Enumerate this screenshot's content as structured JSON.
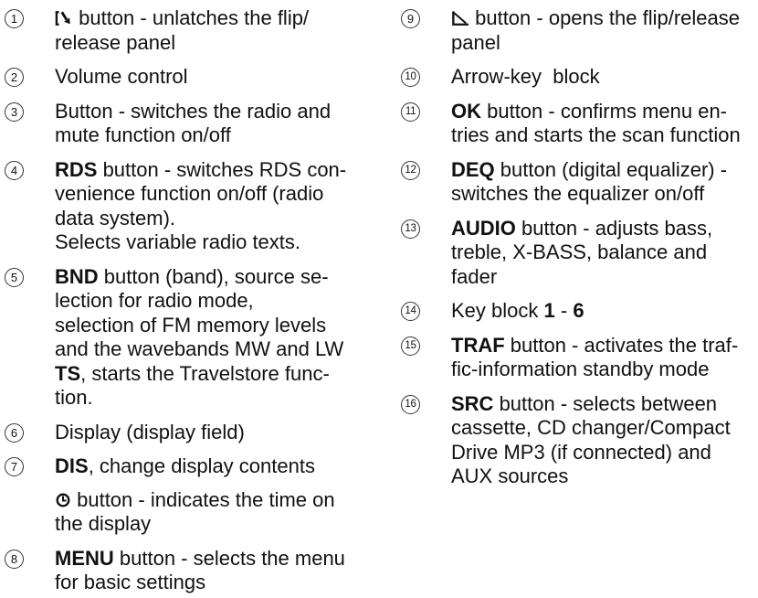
{
  "colors": {
    "text": "#111111",
    "number_circle": "#333333",
    "background": "#ffffff"
  },
  "left_column": {
    "items": [
      {
        "number": "1",
        "paragraphs": [
          [
            [
              {
                "icon": "flip-release-icon"
              },
              {
                "text": " button - unlatches the flip/"
              }
            ],
            [
              {
                "text": "release panel"
              }
            ]
          ]
        ]
      },
      {
        "number": "2",
        "paragraphs": [
          [
            [
              {
                "text": "Volume control"
              }
            ]
          ]
        ]
      },
      {
        "number": "3",
        "paragraphs": [
          [
            [
              {
                "text": "Button - switches the radio and"
              }
            ],
            [
              {
                "text": "mute function on/off"
              }
            ]
          ]
        ]
      },
      {
        "number": "4",
        "paragraphs": [
          [
            [
              {
                "text": "RDS",
                "bold": true
              },
              {
                "text": " button - switches RDS con-"
              }
            ],
            [
              {
                "text": "venience function on/off (radio"
              }
            ],
            [
              {
                "text": "data system)."
              }
            ],
            [
              {
                "text": "Selects variable radio texts."
              }
            ]
          ]
        ]
      },
      {
        "number": "5",
        "paragraphs": [
          [
            [
              {
                "text": "BND",
                "bold": true
              },
              {
                "text": " button (band), source se-"
              }
            ],
            [
              {
                "text": "lection for radio mode,"
              }
            ],
            [
              {
                "text": "selection of FM memory levels"
              }
            ],
            [
              {
                "text": "and the wavebands MW and LW"
              }
            ],
            [
              {
                "text": "TS",
                "bold": true
              },
              {
                "text": ", starts the Travelstore func-"
              }
            ],
            [
              {
                "text": "tion."
              }
            ]
          ]
        ]
      },
      {
        "number": "6",
        "paragraphs": [
          [
            [
              {
                "text": "Display (display field)"
              }
            ]
          ]
        ]
      },
      {
        "number": "7",
        "paragraphs": [
          [
            [
              {
                "text": "DIS",
                "bold": true
              },
              {
                "text": ", change display contents"
              }
            ]
          ],
          [
            [
              {
                "icon": "clock-icon"
              },
              {
                "text": " button - indicates the time on"
              }
            ],
            [
              {
                "text": "the display"
              }
            ]
          ]
        ]
      },
      {
        "number": "8",
        "paragraphs": [
          [
            [
              {
                "text": "MENU",
                "bold": true
              },
              {
                "text": " button - selects the menu"
              }
            ],
            [
              {
                "text": "for basic settings"
              }
            ]
          ]
        ]
      }
    ]
  },
  "right_column": {
    "items": [
      {
        "number": "9",
        "paragraphs": [
          [
            [
              {
                "icon": "open-panel-icon"
              },
              {
                "text": " button - opens the flip/release"
              }
            ],
            [
              {
                "text": "panel"
              }
            ]
          ]
        ]
      },
      {
        "number": "10",
        "paragraphs": [
          [
            [
              {
                "text": "Arrow-key  block"
              }
            ]
          ]
        ]
      },
      {
        "number": "11",
        "paragraphs": [
          [
            [
              {
                "text": "OK",
                "bold": true
              },
              {
                "text": " button - confirms menu en-"
              }
            ],
            [
              {
                "text": "tries and starts the scan function"
              }
            ]
          ]
        ]
      },
      {
        "number": "12",
        "paragraphs": [
          [
            [
              {
                "text": "DEQ",
                "bold": true
              },
              {
                "text": " button (digital equalizer) -"
              }
            ],
            [
              {
                "text": "switches the equalizer on/off"
              }
            ]
          ]
        ]
      },
      {
        "number": "13",
        "paragraphs": [
          [
            [
              {
                "text": "AUDIO",
                "bold": true
              },
              {
                "text": " button - adjusts bass,"
              }
            ],
            [
              {
                "text": "treble, X-BASS, balance and"
              }
            ],
            [
              {
                "text": "fader"
              }
            ]
          ]
        ]
      },
      {
        "number": "14",
        "paragraphs": [
          [
            [
              {
                "text": "Key block "
              },
              {
                "text": "1",
                "bold": true
              },
              {
                "text": " - "
              },
              {
                "text": "6",
                "bold": true
              }
            ]
          ]
        ]
      },
      {
        "number": "15",
        "paragraphs": [
          [
            [
              {
                "text": "TRAF",
                "bold": true
              },
              {
                "text": " button - activates the traf-"
              }
            ],
            [
              {
                "text": "fic-information standby mode"
              }
            ]
          ]
        ]
      },
      {
        "number": "16",
        "paragraphs": [
          [
            [
              {
                "text": "SRC",
                "bold": true
              },
              {
                "text": " button - selects between"
              }
            ],
            [
              {
                "text": "cassette, CD changer/Compact"
              }
            ],
            [
              {
                "text": "Drive MP3 (if connected) and"
              }
            ],
            [
              {
                "text": "AUX sources"
              }
            ]
          ]
        ]
      }
    ]
  }
}
